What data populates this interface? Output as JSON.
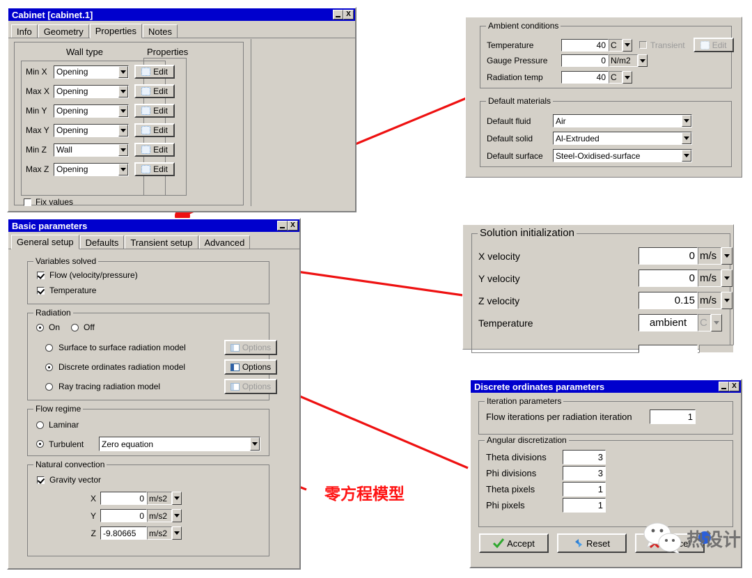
{
  "cabinet_dialog": {
    "title": "Cabinet [cabinet.1]",
    "minimize": "_",
    "close": "X",
    "tabs": [
      {
        "label": "Info",
        "selected": false
      },
      {
        "label": "Geometry",
        "selected": false
      },
      {
        "label": "Properties",
        "selected": true
      },
      {
        "label": "Notes",
        "selected": false
      }
    ],
    "columns": {
      "wall_type": "Wall type",
      "properties": "Properties"
    },
    "rows": [
      {
        "label": "Min X",
        "value": "Opening",
        "button": "Edit"
      },
      {
        "label": "Max X",
        "value": "Opening",
        "button": "Edit"
      },
      {
        "label": "Min Y",
        "value": "Opening",
        "button": "Edit"
      },
      {
        "label": "Max Y",
        "value": "Opening",
        "button": "Edit"
      },
      {
        "label": "Min Z",
        "value": "Wall",
        "button": "Edit"
      },
      {
        "label": "Max Z",
        "value": "Opening",
        "button": "Edit"
      }
    ],
    "fix_values": {
      "label": "Fix values",
      "checked": false
    }
  },
  "ambient_panel": {
    "ambient_group": "Ambient conditions",
    "temperature": {
      "label": "Temperature",
      "value": "40",
      "unit": "C"
    },
    "gauge_pressure": {
      "label": "Gauge Pressure",
      "value": "0",
      "unit": "N/m2"
    },
    "radiation_temp": {
      "label": "Radiation temp",
      "value": "40",
      "unit": "C"
    },
    "transient": {
      "label": "Transient",
      "checked": false
    },
    "edit_button": "Edit",
    "materials_group": "Default materials",
    "default_fluid": {
      "label": "Default fluid",
      "value": "Air"
    },
    "default_solid": {
      "label": "Default solid",
      "value": "Al-Extruded"
    },
    "default_surface": {
      "label": "Default surface",
      "value": "Steel-Oxidised-surface"
    }
  },
  "basic_parameters": {
    "title": "Basic parameters",
    "minimize": "_",
    "close": "X",
    "tabs": [
      {
        "label": "General setup",
        "selected": true
      },
      {
        "label": "Defaults",
        "selected": false
      },
      {
        "label": "Transient setup",
        "selected": false
      },
      {
        "label": "Advanced",
        "selected": false
      }
    ],
    "variables_group": "Variables solved",
    "flow": {
      "label": "Flow (velocity/pressure)",
      "checked": true
    },
    "temperature": {
      "label": "Temperature",
      "checked": true
    },
    "radiation_group": "Radiation",
    "radiation_on": {
      "label": "On",
      "selected": true
    },
    "radiation_off": {
      "label": "Off",
      "selected": false
    },
    "models": [
      {
        "label": "Surface to surface radiation model",
        "selected": false,
        "button": "Options",
        "enabled": false
      },
      {
        "label": "Discrete ordinates radiation model",
        "selected": true,
        "button": "Options",
        "enabled": true
      },
      {
        "label": "Ray tracing radiation model",
        "selected": false,
        "button": "Options",
        "enabled": false
      }
    ],
    "flow_regime_group": "Flow regime",
    "laminar": {
      "label": "Laminar",
      "selected": false
    },
    "turbulent": {
      "label": "Turbulent",
      "selected": true,
      "model": "Zero equation"
    },
    "natural_convection_group": "Natural convection",
    "gravity_vector": {
      "label": "Gravity vector",
      "checked": true
    },
    "gravity": [
      {
        "axis": "X",
        "value": "0",
        "unit": "m/s2"
      },
      {
        "axis": "Y",
        "value": "0",
        "unit": "m/s2"
      },
      {
        "axis": "Z",
        "value": "-9.80665",
        "unit": "m/s2"
      }
    ]
  },
  "solution_panel": {
    "group": "Solution initialization",
    "rows": [
      {
        "label": "X velocity",
        "value": "0",
        "unit": "m/s",
        "enabled": true
      },
      {
        "label": "Y velocity",
        "value": "0",
        "unit": "m/s",
        "enabled": true
      },
      {
        "label": "Z velocity",
        "value": "0.15",
        "unit": "m/s",
        "enabled": true
      },
      {
        "label": "Temperature",
        "value": "ambient",
        "unit": "C",
        "enabled": false
      }
    ]
  },
  "discrete_dialog": {
    "title": "Discrete ordinates parameters",
    "minimize": "_",
    "close": "X",
    "iteration_group": "Iteration parameters",
    "flow_iterations": {
      "label": "Flow iterations per radiation iteration",
      "value": "1"
    },
    "angular_group": "Angular discretization",
    "angular_rows": [
      {
        "label": "Theta divisions",
        "value": "3"
      },
      {
        "label": "Phi divisions",
        "value": "3"
      },
      {
        "label": "Theta pixels",
        "value": "1"
      },
      {
        "label": "Phi pixels",
        "value": "1"
      }
    ],
    "buttons": [
      {
        "label": "Accept",
        "icon": "check-icon"
      },
      {
        "label": "Reset",
        "icon": "refresh-icon"
      },
      {
        "label": "Cancel",
        "icon": "cross-icon"
      }
    ]
  },
  "annotation": {
    "text": "零方程模型",
    "color": "#ff1414"
  },
  "watermark": {
    "text": "热设计"
  }
}
